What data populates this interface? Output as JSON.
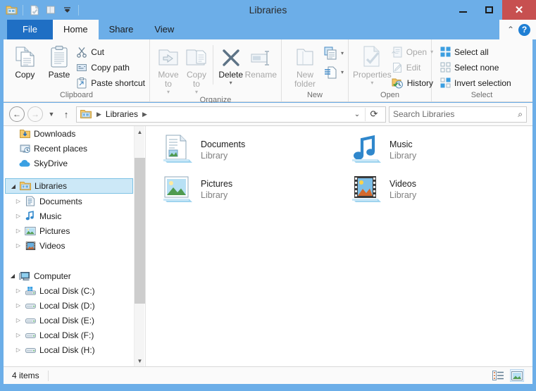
{
  "window": {
    "title": "Libraries",
    "accent_color": "#6caee8",
    "close_color": "#c75050",
    "controls": {
      "minimize": "Minimize",
      "maximize": "Maximize",
      "close": "Close"
    },
    "quick_access": [
      {
        "name": "explorer-icon",
        "tooltip": "File Explorer"
      },
      {
        "name": "properties-icon",
        "tooltip": "Properties"
      },
      {
        "name": "new-folder-icon",
        "tooltip": "New folder"
      },
      {
        "name": "customize-qat-icon",
        "tooltip": "Customize Quick Access Toolbar"
      }
    ]
  },
  "tabs": [
    {
      "label": "File",
      "name": "tab-file",
      "state": "file"
    },
    {
      "label": "Home",
      "name": "tab-home",
      "state": "active"
    },
    {
      "label": "Share",
      "name": "tab-share",
      "state": "normal"
    },
    {
      "label": "View",
      "name": "tab-view",
      "state": "normal"
    }
  ],
  "tabstrip_right": {
    "collapse_label": "Minimize the Ribbon",
    "help_label": "?"
  },
  "ribbon": {
    "groups": [
      {
        "name": "clipboard",
        "label": "Clipboard",
        "big_buttons": [
          {
            "label": "Copy",
            "icon": "copy-icon",
            "dim": false
          },
          {
            "label": "Paste",
            "icon": "paste-icon",
            "dim": false
          }
        ],
        "small_buttons": [
          {
            "label": "Cut",
            "icon": "cut-icon",
            "dim": false
          },
          {
            "label": "Copy path",
            "icon": "copy-path-icon",
            "dim": false
          },
          {
            "label": "Paste shortcut",
            "icon": "paste-shortcut-icon",
            "dim": false
          }
        ]
      },
      {
        "name": "organize",
        "label": "Organize",
        "big_buttons": [
          {
            "label": "Move to",
            "icon": "move-to-icon",
            "dim": true,
            "caret": true
          },
          {
            "label": "Copy to",
            "icon": "copy-to-icon",
            "dim": true,
            "caret": true
          },
          {
            "label": "Delete",
            "icon": "delete-icon",
            "dim": false,
            "caret": true
          },
          {
            "label": "Rename",
            "icon": "rename-icon",
            "dim": true,
            "caret": false
          }
        ]
      },
      {
        "name": "new",
        "label": "New",
        "big_buttons": [
          {
            "label": "New folder",
            "icon": "new-folder-icon",
            "dim": true
          }
        ],
        "small_buttons": [
          {
            "label": "",
            "icon": "new-item-icon",
            "dim": false,
            "caret": true
          },
          {
            "label": "",
            "icon": "easy-access-icon",
            "dim": false,
            "caret": true
          }
        ]
      },
      {
        "name": "open",
        "label": "Open",
        "big_buttons": [
          {
            "label": "Properties",
            "icon": "properties-icon",
            "dim": true,
            "caret": true
          }
        ],
        "small_buttons": [
          {
            "label": "Open",
            "icon": "open-icon",
            "dim": true,
            "caret": true
          },
          {
            "label": "Edit",
            "icon": "edit-icon",
            "dim": true
          },
          {
            "label": "History",
            "icon": "history-icon",
            "dim": false
          }
        ]
      },
      {
        "name": "select",
        "label": "Select",
        "small_buttons": [
          {
            "label": "Select all",
            "icon": "select-all-icon",
            "dim": false
          },
          {
            "label": "Select none",
            "icon": "select-none-icon",
            "dim": false
          },
          {
            "label": "Invert selection",
            "icon": "invert-selection-icon",
            "dim": false
          }
        ]
      }
    ]
  },
  "addressbar": {
    "back_label": "Back",
    "forward_label": "Forward",
    "recent_label": "Recent locations",
    "up_label": "Up",
    "breadcrumb": [
      "Libraries"
    ],
    "breadcrumb_root_icon": "libraries-icon",
    "refresh_label": "Refresh"
  },
  "search": {
    "placeholder": "Search Libraries",
    "value": "",
    "icon": "search-icon"
  },
  "navpane": {
    "items": [
      {
        "label": "Downloads",
        "icon": "downloads-icon",
        "indent": 1,
        "expander": "none",
        "selected": false
      },
      {
        "label": "Recent places",
        "icon": "recent-places-icon",
        "indent": 1,
        "expander": "none",
        "selected": false
      },
      {
        "label": "SkyDrive",
        "icon": "skydrive-icon",
        "indent": 1,
        "expander": "none",
        "selected": false
      },
      {
        "label": "Libraries",
        "icon": "libraries-icon",
        "indent": 0,
        "expander": "expanded",
        "selected": true
      },
      {
        "label": "Documents",
        "icon": "documents-icon",
        "indent": 1,
        "expander": "collapsed",
        "selected": false
      },
      {
        "label": "Music",
        "icon": "music-icon",
        "indent": 1,
        "expander": "collapsed",
        "selected": false
      },
      {
        "label": "Pictures",
        "icon": "pictures-icon",
        "indent": 1,
        "expander": "collapsed",
        "selected": false
      },
      {
        "label": "Videos",
        "icon": "videos-icon",
        "indent": 1,
        "expander": "collapsed",
        "selected": false
      },
      {
        "label": "Computer",
        "icon": "computer-icon",
        "indent": 0,
        "expander": "expanded",
        "selected": false
      },
      {
        "label": "Local Disk (C:)",
        "icon": "system-disk-icon",
        "indent": 1,
        "expander": "collapsed",
        "selected": false
      },
      {
        "label": "Local Disk (D:)",
        "icon": "disk-icon",
        "indent": 1,
        "expander": "collapsed",
        "selected": false
      },
      {
        "label": "Local Disk (E:)",
        "icon": "disk-icon",
        "indent": 1,
        "expander": "collapsed",
        "selected": false
      },
      {
        "label": "Local Disk (F:)",
        "icon": "disk-icon",
        "indent": 1,
        "expander": "collapsed",
        "selected": false
      },
      {
        "label": "Local Disk (H:)",
        "icon": "disk-icon",
        "indent": 1,
        "expander": "collapsed",
        "selected": false
      }
    ],
    "scrollbar": {
      "up_arrow": "scroll-up-icon",
      "down_arrow": "scroll-down-icon"
    }
  },
  "content": {
    "items": [
      {
        "name": "Documents",
        "subtitle": "Library",
        "icon": "documents-library-icon"
      },
      {
        "name": "Music",
        "subtitle": "Library",
        "icon": "music-library-icon"
      },
      {
        "name": "Pictures",
        "subtitle": "Library",
        "icon": "pictures-library-icon"
      },
      {
        "name": "Videos",
        "subtitle": "Library",
        "icon": "videos-library-icon"
      }
    ]
  },
  "statusbar": {
    "item_count": "4 items",
    "view_details_label": "Details view",
    "view_large_label": "Large icons view"
  }
}
